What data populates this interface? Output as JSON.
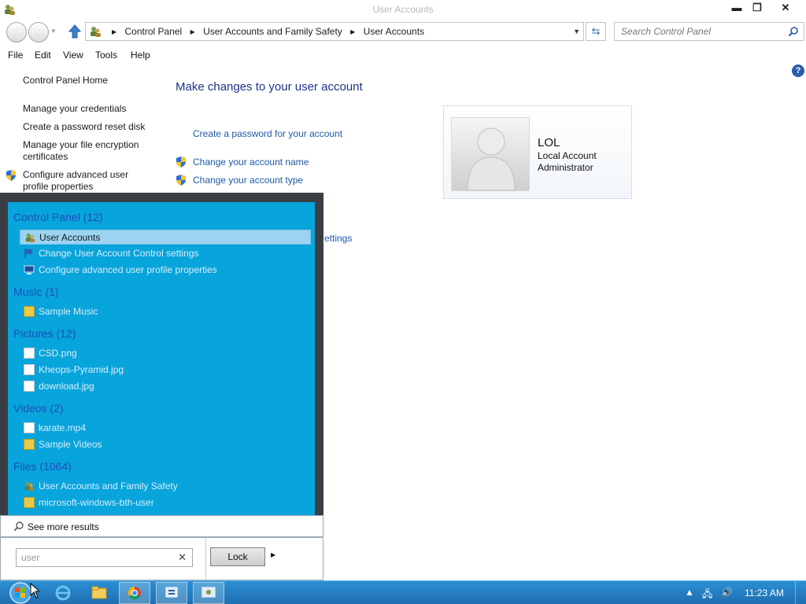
{
  "window": {
    "title": "User Accounts",
    "minimize": "▬",
    "maximize": "❐",
    "close": "✕"
  },
  "address_bar": {
    "breadcrumbs": [
      "Control Panel",
      "User Accounts and Family Safety",
      "User Accounts"
    ]
  },
  "search": {
    "placeholder": "Search Control Panel"
  },
  "menu": [
    "File",
    "Edit",
    "View",
    "Tools",
    "Help"
  ],
  "sidebar": {
    "home": "Control Panel Home",
    "links": [
      "Manage your credentials",
      "Create a password reset disk",
      "Manage your file encryption certificates",
      "Configure advanced user profile properties"
    ]
  },
  "main": {
    "title": "Make changes to your user account",
    "tasks": [
      "Create a password for your account",
      "Change your account name",
      "Change your account type"
    ],
    "partial_task": "ettings",
    "help": "?"
  },
  "account": {
    "name": "LOL",
    "type": "Local Account",
    "role": "Administrator"
  },
  "start_menu": {
    "groups": [
      {
        "label": "Control Panel (12)",
        "items": [
          "User Accounts",
          "Change User Account Control settings",
          "Configure advanced user profile properties"
        ]
      },
      {
        "label": "Music (1)",
        "items": [
          "Sample Music"
        ]
      },
      {
        "label": "Pictures (12)",
        "items": [
          "CSD.png",
          "Kheops-Pyramid.jpg",
          "download.jpg"
        ]
      },
      {
        "label": "Videos (2)",
        "items": [
          "karate.mp4",
          "Sample Videos"
        ]
      },
      {
        "label": "Files (1064)",
        "items": [
          "User Accounts and Family Safety",
          "microsoft-windows-bth-user"
        ]
      }
    ],
    "see_more": "See more results",
    "search_value": "user",
    "clear": "✕",
    "lock": "Lock"
  },
  "taskbar": {
    "clock": "11:23 AM",
    "accent": "#1f6fb0"
  }
}
